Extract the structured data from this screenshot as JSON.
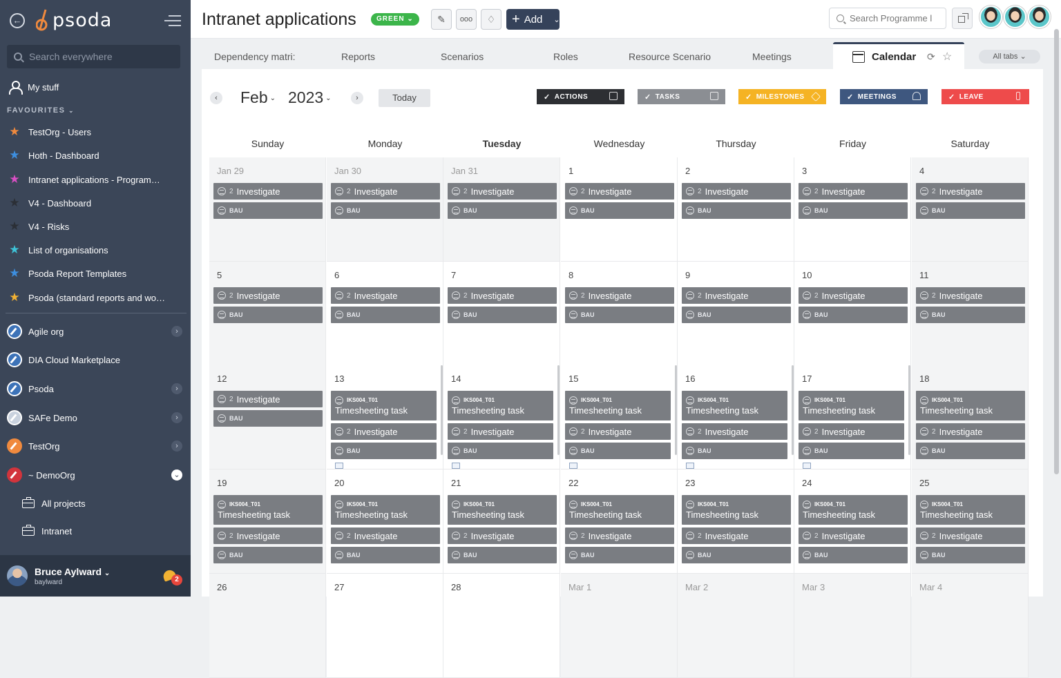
{
  "sidebar": {
    "logo_text": "psoda",
    "search_placeholder": "Search everywhere",
    "my_stuff": "My stuff",
    "favourites_header": "FAVOURITES",
    "favourites": [
      {
        "label": "TestOrg - Users",
        "color": "#f08a3e"
      },
      {
        "label": "Hoth - Dashboard",
        "color": "#3d8fe0"
      },
      {
        "label": "Intranet applications - Programme...",
        "color": "#d94fc5"
      },
      {
        "label": "V4 - Dashboard",
        "color": "#2b2f36"
      },
      {
        "label": "V4 - Risks",
        "color": "#2b2f36"
      },
      {
        "label": "List of organisations",
        "color": "#3ec3d8"
      },
      {
        "label": "Psoda Report Templates",
        "color": "#3d8fe0"
      },
      {
        "label": "Psoda (standard reports and work...",
        "color": "#f2b233"
      }
    ],
    "orgs": [
      {
        "label": "Agile org",
        "chevron": ">"
      },
      {
        "label": "DIA Cloud Marketplace",
        "chevron": ""
      },
      {
        "label": "Psoda",
        "chevron": ">"
      },
      {
        "label": "SAFe Demo",
        "chevron": ">"
      },
      {
        "label": "TestOrg",
        "chevron": ">"
      },
      {
        "label": "~ DemoOrg",
        "chevron": "v"
      }
    ],
    "sub_items": [
      "All projects",
      "Intranet"
    ],
    "user": {
      "name": "Bruce Aylward",
      "username": "baylward",
      "notifications": "2"
    }
  },
  "topbar": {
    "title": "Intranet applications",
    "status": "GREEN",
    "add_label": "Add",
    "search_placeholder": "Search Programme l"
  },
  "tabs": {
    "items": [
      "Dependency matri:",
      "Reports",
      "Scenarios",
      "Roles",
      "Resource Scenario:",
      "Meetings"
    ],
    "active": "Calendar",
    "all_tabs": "All tabs"
  },
  "calendar": {
    "month": "Feb",
    "year": "2023",
    "today": "Today",
    "filters": [
      {
        "label": "ACTIONS",
        "color": "#2d2f33"
      },
      {
        "label": "TASKS",
        "color": "#8b8e93"
      },
      {
        "label": "MILESTONES",
        "color": "#f5b324"
      },
      {
        "label": "MEETINGS",
        "color": "#3e577f"
      },
      {
        "label": "LEAVE",
        "color": "#ee4b4b"
      }
    ],
    "days_of_week": [
      "Sunday",
      "Monday",
      "Tuesday",
      "Wednesday",
      "Thursday",
      "Friday",
      "Saturday"
    ],
    "event_labels": {
      "investigate": "Investigate",
      "investigate_count": "2",
      "bau": "BAU",
      "task_code": "IKS004_T01",
      "task_name": "Timesheeting task"
    },
    "weeks": [
      [
        "Jan 29",
        "Jan 30",
        "Jan 31",
        "1",
        "2",
        "3",
        "4"
      ],
      [
        "5",
        "6",
        "7",
        "8",
        "9",
        "10",
        "11"
      ],
      [
        "12",
        "13",
        "14",
        "15",
        "16",
        "17",
        "18"
      ],
      [
        "19",
        "20",
        "21",
        "22",
        "23",
        "24",
        "25"
      ],
      [
        "26",
        "27",
        "28",
        "Mar 1",
        "Mar 2",
        "Mar 3",
        "Mar 4"
      ]
    ]
  }
}
